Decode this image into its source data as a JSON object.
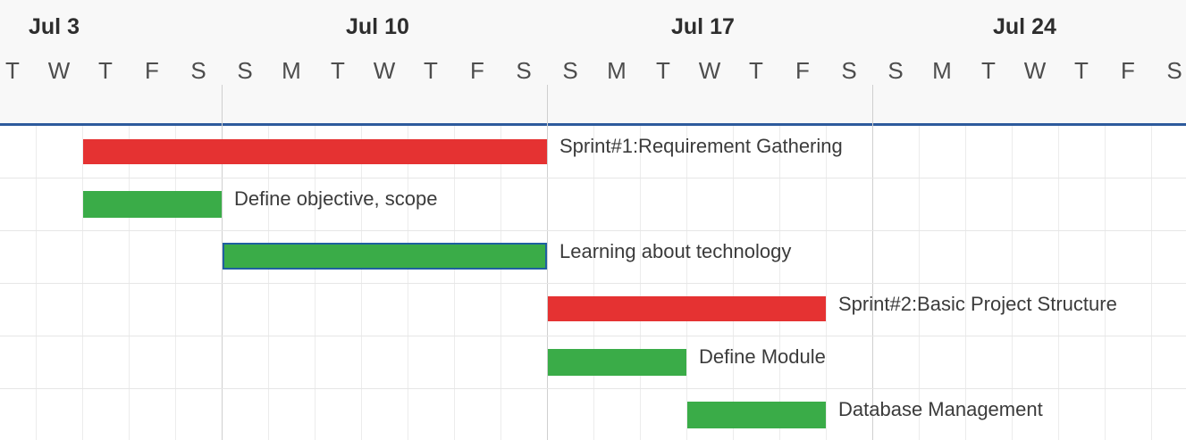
{
  "timeline": {
    "weeks": [
      "Jul 3",
      "Jul 10",
      "Jul 17",
      "Jul 24"
    ],
    "days": [
      "T",
      "W",
      "T",
      "F",
      "S",
      "S",
      "M",
      "T",
      "W",
      "T",
      "F",
      "S",
      "S",
      "M",
      "T",
      "W",
      "T",
      "F",
      "S",
      "S",
      "M",
      "T",
      "W",
      "T",
      "F",
      "S"
    ]
  },
  "tasks": [
    {
      "label": "Sprint#1:Requirement Gathering",
      "type": "sprint",
      "color": "#e53232"
    },
    {
      "label": "Define objective, scope",
      "type": "task",
      "color": "#3aac48"
    },
    {
      "label": "Learning about technology",
      "type": "task",
      "color": "#3aac48",
      "selected": true
    },
    {
      "label": "Sprint#2:Basic Project Structure",
      "type": "sprint",
      "color": "#e53232"
    },
    {
      "label": "Define Module",
      "type": "task",
      "color": "#3aac48"
    },
    {
      "label": "Database Management",
      "type": "task",
      "color": "#3aac48"
    }
  ],
  "colors": {
    "header_line": "#2d5a9c",
    "sprint": "#e53232",
    "task": "#3aac48",
    "selection_border": "#1f5fa0"
  }
}
